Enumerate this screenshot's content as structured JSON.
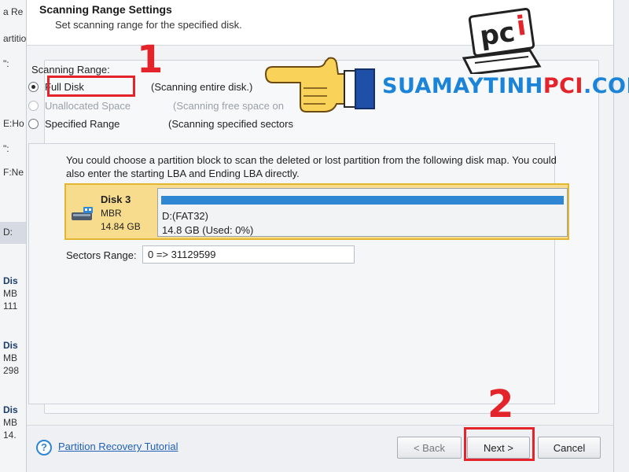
{
  "background_app": {
    "left_fragments": [
      "a Re",
      "artition",
      "\":",
      "E:Ho",
      "\":",
      "F:Ne",
      "D:",
      "Dis",
      "MB",
      "111",
      "Dis",
      "MB",
      "298",
      "Dis",
      "MB",
      "14."
    ]
  },
  "dialog": {
    "title": "Scanning Range Settings",
    "subtitle": "Set scanning range for the specified disk."
  },
  "scanning_range": {
    "label": "Scanning Range:",
    "options": [
      {
        "label": "Full Disk",
        "description": "(Scanning entire disk.)",
        "selected": true,
        "enabled": true
      },
      {
        "label": "Unallocated Space",
        "description": "(Scanning free space on",
        "selected": false,
        "enabled": false
      },
      {
        "label": "Specified Range",
        "description": "(Scanning specified sectors",
        "selected": false,
        "enabled": true
      }
    ]
  },
  "disk_map": {
    "instructions": "You could choose a partition block to scan the deleted or lost partition from the following disk map. You could also enter the starting LBA and Ending LBA directly.",
    "disk": {
      "name": "Disk 3",
      "type": "MBR",
      "size": "14.84 GB"
    },
    "partition": {
      "name": "D:(FAT32)",
      "info": "14.8 GB (Used: 0%)",
      "used_fraction": 0.0
    }
  },
  "sectors": {
    "label": "Sectors Range:",
    "value": "0 => 31129599"
  },
  "footer": {
    "tutorial_link": "Partition Recovery Tutorial",
    "back_label": "< Back",
    "next_label": "Next >",
    "cancel_label": "Cancel"
  },
  "annotations": {
    "step1": "1",
    "step2": "2",
    "marker_color": "#e3242b"
  },
  "watermark": {
    "logo_letters": "pci",
    "site_main": "SUAMAYTINH",
    "site_accent": "PCI",
    "site_tail": ".COM"
  },
  "colors": {
    "accent": "#2f86d2",
    "disk_highlight": "#f7dc8d",
    "link": "#2161b6"
  }
}
